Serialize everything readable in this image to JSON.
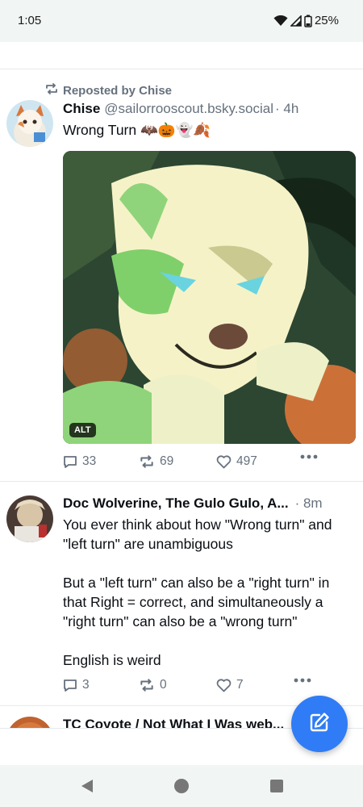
{
  "status": {
    "time": "1:05",
    "battery": "25%"
  },
  "post1": {
    "repost_label": "Reposted by Chise",
    "author": "Chise",
    "handle": "@sailorrooscout.bsky.social",
    "time": "· 4h",
    "text": "Wrong Turn 🦇🎃👻🍂",
    "alt": "ALT",
    "replies": "33",
    "reposts": "69",
    "likes": "497"
  },
  "post2": {
    "author": "Doc Wolverine, The Gulo Gulo, A...",
    "time": "· 8m",
    "paragraphs": [
      "You ever think about how \"Wrong turn\" and \"left turn\" are unambiguous",
      "But a \"left turn\" can also be a \"right turn\" in that Right = correct, and simultaneously a \"right turn\" can also be a \"wrong turn\"",
      "English is weird"
    ],
    "replies": "3",
    "reposts": "0",
    "likes": "7"
  },
  "post3": {
    "author": "TC Coyote / Not What I Was web..."
  },
  "colors": {
    "accent": "#2f7cf6",
    "muted": "#66717d",
    "text": "#0b0f14"
  },
  "icons": [
    "wifi-icon",
    "signal-icon",
    "battery-icon",
    "repost-icon",
    "reply-icon",
    "like-icon",
    "more-icon",
    "compose-icon",
    "back-icon",
    "home-icon",
    "recents-icon"
  ]
}
